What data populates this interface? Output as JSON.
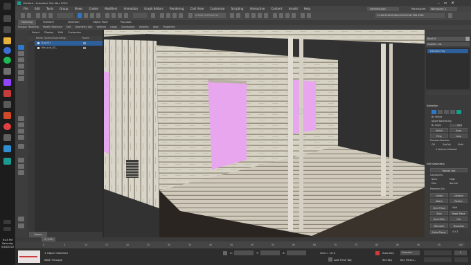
{
  "window": {
    "title": "Untitled - Autodesk 3ds Max 2020",
    "user": "wellerhougen",
    "workspace_label": "Workspaces:",
    "workspace_value": "Workspace_1"
  },
  "menu": [
    "File",
    "Edit",
    "Tools",
    "Group",
    "Views",
    "Create",
    "Modifiers",
    "Animation",
    "Graph Editors",
    "Rendering",
    "Civil View",
    "Customize",
    "Scripting",
    "Interactive",
    "Content",
    "Arnold",
    "Help"
  ],
  "toolbar": {
    "selection_set_placeholder": "Create Selection Se",
    "project_path": "C:\\Users\\Owner\\Documents\\3ds Max 2020"
  },
  "ribbon": {
    "tabs": [
      "Modeling",
      "Freeform",
      "Selection",
      "Object Paint",
      "Populate"
    ],
    "row": [
      "Polygon Modeling",
      "Modify Selection",
      "Edit",
      "Geometry (All)",
      "Vertices",
      "Loops",
      "Subdivision",
      "Visibility",
      "Align",
      "Properties"
    ]
  },
  "explorer": {
    "tabs": [
      "Select",
      "Display",
      "Edit",
      "Customize"
    ],
    "col_name": "Name (Sorted Ascending)",
    "col_frozen": "Frozen",
    "rows": [
      "Box001",
      "tile_sub_02_"
    ],
    "bottom_label": "Scene Explorer"
  },
  "viewport": {
    "label": "[+] [Perspective] [Standard] [Default Shading]"
  },
  "cmdpanel": {
    "object_name": "Box001",
    "modifier_list": "Modifier List",
    "stack_item": "Editable Poly",
    "selection_title": "Selection",
    "by_vertex": "By Vertex",
    "ignore_backfacing": "Ignore Backfacing",
    "by_angle": "By Angle",
    "angle_value": "45.0",
    "shrink": "Shrink",
    "grow": "Grow",
    "ring": "Ring",
    "loop": "Loop",
    "preview_selection": "Preview Selection",
    "off": "Off",
    "subobj": "SubObj",
    "multi": "Multi",
    "vertices_selected": "0 Vertices Selected",
    "edit_geometry_title": "Edit Geometry",
    "repeat_last": "Repeat Last",
    "constraints": "Constraints",
    "none": "None",
    "edge": "Edge",
    "face": "Face",
    "normal": "Normal",
    "preserve_uvs": "Preserve UVs",
    "create": "Create",
    "collapse": "Collapse",
    "attach": "Attach",
    "detach": "Detach",
    "slice_plane": "Slice Plane",
    "split": "Split",
    "slice": "Slice",
    "reset_plane": "Reset Plane",
    "quickslice": "QuickSlice",
    "cut": "Cut",
    "meshsmooth": "MSmooth",
    "tessellate": "Tessellate",
    "make_planar": "Make Planar",
    "xyz": "X  Y  Z"
  },
  "timeline": {
    "frame_display": "0 / 100",
    "ticks": [
      "0",
      "5",
      "10",
      "15",
      "20",
      "25",
      "30",
      "35",
      "40",
      "45",
      "50",
      "55",
      "60",
      "65",
      "70",
      "75",
      "80",
      "85",
      "90",
      "95",
      "100"
    ]
  },
  "status": {
    "selection": "1 Object Selected",
    "prompt": "Walk Through",
    "x_label": "X:",
    "y_label": "Y:",
    "z_label": "Z:",
    "grid": "Grid = 10.0",
    "add_time_tag": "Add Time Tag",
    "auto_key": "Auto Key",
    "set_key": "Set Key",
    "key_filters": "Key Filters...",
    "selected": "Selected",
    "frame_field": "0"
  },
  "clock": {
    "time": "9:25 PM",
    "day": "Saturday",
    "date": "5/28/2022"
  },
  "colors": {
    "accent": "#2f77c8",
    "wall_pink": "#e8a6ee",
    "wood_light": "#d9d6cc",
    "wood_dark": "#9a9382",
    "selected_row": "#2d5f9a"
  }
}
